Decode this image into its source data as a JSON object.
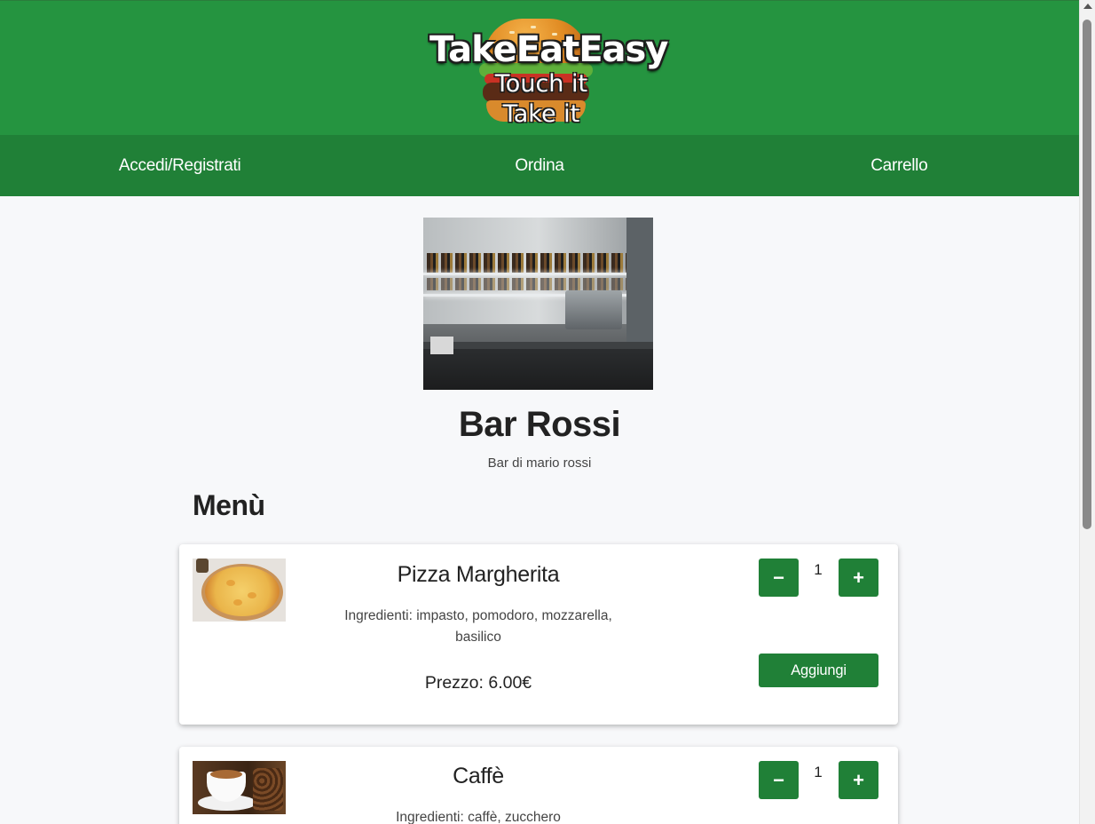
{
  "header": {
    "logo_title": "TakeEatEasy",
    "logo_tagline_1": "Touch it",
    "logo_tagline_2": "Take it"
  },
  "nav": {
    "items": [
      {
        "label": "Accedi/Registrati"
      },
      {
        "label": "Ordina"
      },
      {
        "label": "Carrello"
      }
    ]
  },
  "shop": {
    "name": "Bar Rossi",
    "description": "Bar di mario rossi"
  },
  "menu": {
    "title": "Menù",
    "items": [
      {
        "name": "Pizza Margherita",
        "ingredients": "Ingredienti: impasto, pomodoro, mozzarella, basilico",
        "price": "Prezzo: 6.00€",
        "quantity": "1",
        "minus_label": "−",
        "plus_label": "+",
        "add_label": "Aggiungi"
      },
      {
        "name": "Caffè",
        "ingredients": "Ingredienti: caffè, zucchero",
        "quantity": "1",
        "minus_label": "−",
        "plus_label": "+"
      }
    ]
  },
  "colors": {
    "header_green": "#259440",
    "nav_green": "#208037",
    "button_green": "#208037"
  },
  "icons": {
    "logo": "burger-logo-icon",
    "scroll_up": "scroll-up-arrow-icon"
  }
}
